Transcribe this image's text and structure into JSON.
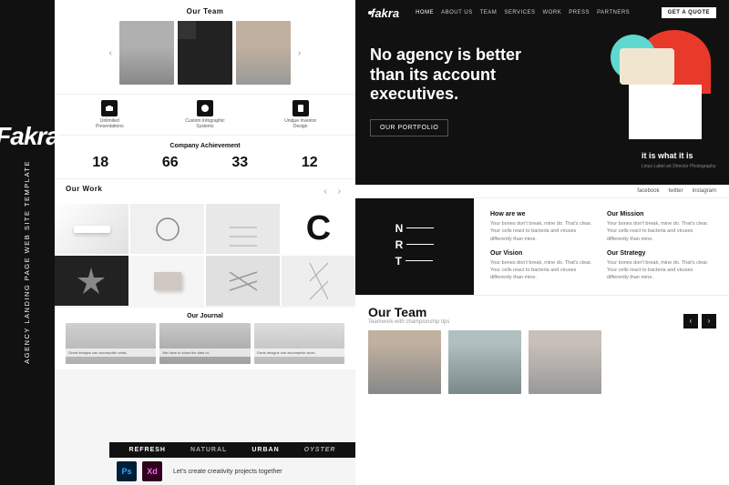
{
  "sidebar": {
    "logo": "Fakra",
    "description": "Agency Landing Page\nWeb Site Template"
  },
  "left": {
    "our_team_title": "Our Team",
    "icons": [
      {
        "label": "Unlimited Presentations"
      },
      {
        "label": "Custom Infographic Systems"
      },
      {
        "label": "Unique Investor Design"
      }
    ],
    "achievement_title": "Company Achievement",
    "achievement_numbers": [
      {
        "num": "18",
        "sub": ""
      },
      {
        "num": "66",
        "sub": ""
      },
      {
        "num": "33",
        "sub": ""
      },
      {
        "num": "12",
        "sub": ""
      }
    ],
    "our_work_title": "Our Work",
    "journal_title": "Our Journal",
    "journal_cards": [
      {
        "caption": "Great designs can accomplish what..."
      },
      {
        "caption": "We have to show the idea of..."
      },
      {
        "caption": "Great designs can accomplish what..."
      }
    ],
    "brands": [
      "REFRESH",
      "natural",
      "Urban",
      "Oyster"
    ],
    "bottom_cta": "Let's create creativity\nprojects together",
    "ps_label": "Ps",
    "xd_label": "Xd"
  },
  "right": {
    "navbar": {
      "logo": "fakra",
      "links": [
        "HOME",
        "ABOUT US",
        "TEAM",
        "SERVICES",
        "WORK",
        "PRESS",
        "PARTNERS"
      ],
      "cta": "GET A QUOTE"
    },
    "hero": {
      "headline_line1": "No agency is better",
      "headline_line2": "than its account",
      "headline_line3": "executives.",
      "cta": "Our Portfolio"
    },
    "it_is_label": "it is\nwhat\nit is",
    "it_is_sub": "Linus Label art Director\nPhotography",
    "social_links": [
      "facebook",
      "twitter",
      "instagram"
    ],
    "info_blocks": [
      {
        "title": "How are we",
        "text": "Your bones don't break, mine do. That's clear. Your cells react to bacteria and viruses differently than mine."
      },
      {
        "title": "Our Mission",
        "text": "Your bones don't break, mine do. That's clear. Your cells react to bacteria and viruses differently than mine."
      },
      {
        "title": "Our Vision",
        "text": "Your bones don't break, mine do. That's clear. Your cells react to bacteria and viruses differently than mine."
      },
      {
        "title": "Our Strategy",
        "text": "Your bones don't break, mine do. That's clear. Your cells react to bacteria and viruses differently than mine."
      }
    ],
    "nrt": {
      "n": "N",
      "r": "R",
      "t": "T"
    },
    "team": {
      "title": "Our Team",
      "subtitle": "Teamwork with championship tips"
    }
  }
}
